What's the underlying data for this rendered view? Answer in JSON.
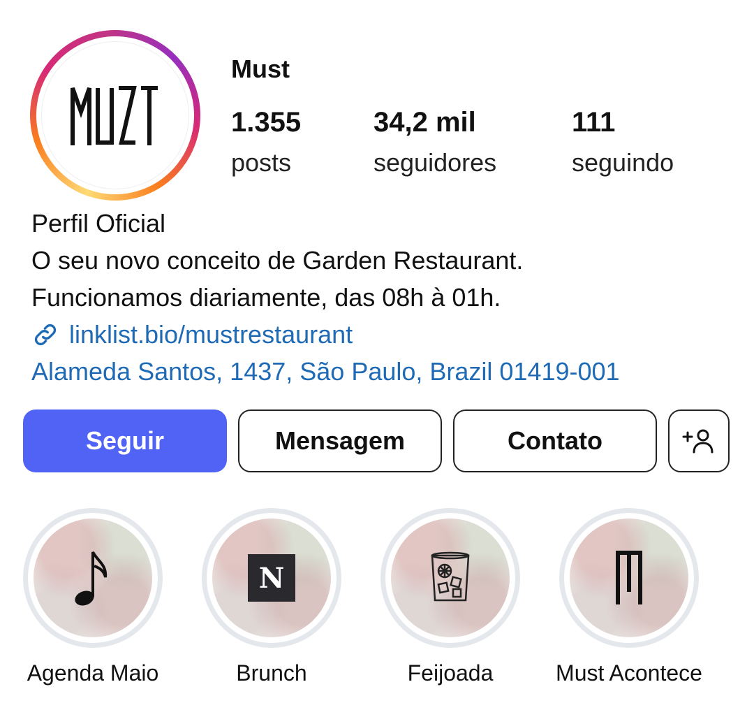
{
  "profile": {
    "username": "Must",
    "avatar_text": "MUST",
    "stats": [
      {
        "value": "1.355",
        "label": "posts"
      },
      {
        "value": "34,2 mil",
        "label": "seguidores"
      },
      {
        "value": "111",
        "label": "seguindo"
      }
    ],
    "bio": {
      "category": "Perfil Oficial",
      "line1": "O seu novo conceito de Garden Restaurant.",
      "line2": "Funcionamos diariamente, das 08h à 01h.",
      "link": "linklist.bio/mustrestaurant",
      "address": "Alameda Santos, 1437, São Paulo, Brazil 01419-001"
    }
  },
  "actions": {
    "follow": "Seguir",
    "message": "Mensagem",
    "contact": "Contato",
    "add_user_icon": "add-person-icon"
  },
  "highlights": [
    {
      "label": "Agenda Maio",
      "icon": "music-note-icon"
    },
    {
      "label": "Brunch",
      "icon": "nespresso-logo-icon",
      "icon_text": "N"
    },
    {
      "label": "Feijoada",
      "icon": "cocktail-glass-icon"
    },
    {
      "label": "Must Acontece",
      "icon": "must-monogram-icon"
    }
  ],
  "colors": {
    "follow_button": "#5163f5",
    "link": "#1f6ab5",
    "highlight_ring": "#e4e7ec"
  }
}
